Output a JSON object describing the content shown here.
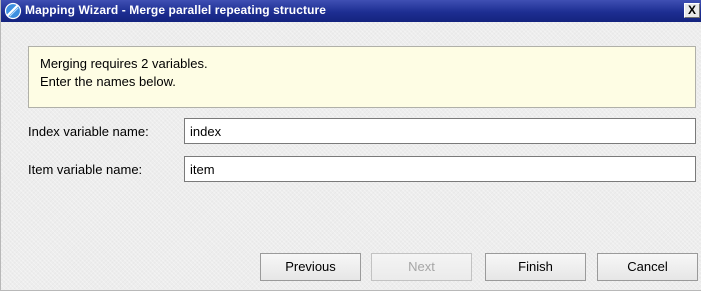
{
  "window": {
    "title": "Mapping Wizard - Merge parallel repeating structure",
    "close_label": "X"
  },
  "message": {
    "line1": "Merging requires 2 variables.",
    "line2": "Enter the names below."
  },
  "fields": {
    "index_label": "Index variable name:",
    "index_value": "index",
    "item_label": "Item variable name:",
    "item_value": "item"
  },
  "buttons": {
    "previous": "Previous",
    "next": "Next",
    "finish": "Finish",
    "cancel": "Cancel"
  },
  "colors": {
    "titlebar": "#1d2e92",
    "message_background": "#fefde4",
    "disabled_text": "#a6a6a6"
  }
}
